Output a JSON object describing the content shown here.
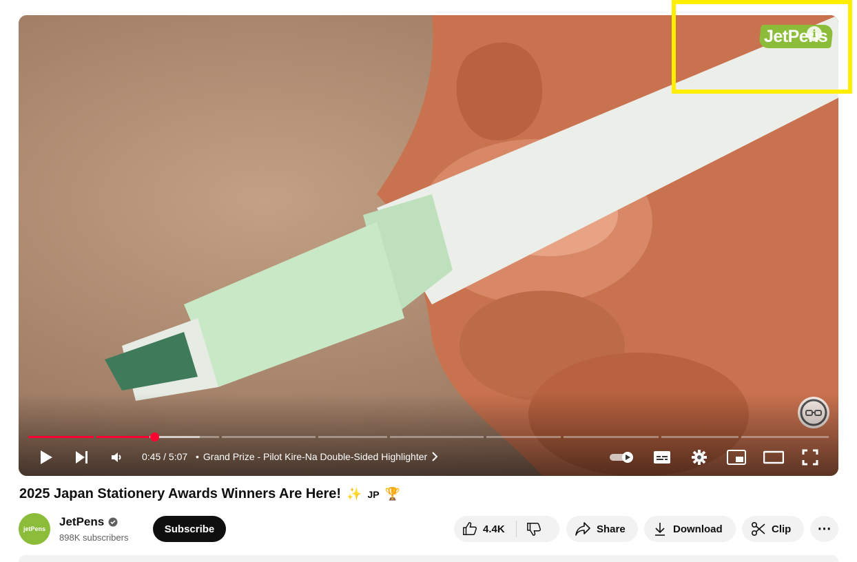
{
  "video": {
    "brand_logo_text": "JetPens",
    "time": "0:45 / 5:07",
    "chapter_title": "Grand Prize - Pilot Kire-Na Double-Sided Highlighter",
    "progress_fraction": 0.147,
    "buffered_fraction": 0.215,
    "accent_color": "#ff0033"
  },
  "details": {
    "title": "2025 Japan Stationery Awards Winners Are Here!",
    "title_emoji": "✨",
    "title_flag": "JP",
    "title_trophy": "🏆",
    "channel_name": "JetPens",
    "avatar_text": "jetPens",
    "subscribers": "898K subscribers",
    "subscribe_label": "Subscribe",
    "likes": "4.4K",
    "share_label": "Share",
    "download_label": "Download",
    "clip_label": "Clip",
    "more_label": "⋯"
  }
}
